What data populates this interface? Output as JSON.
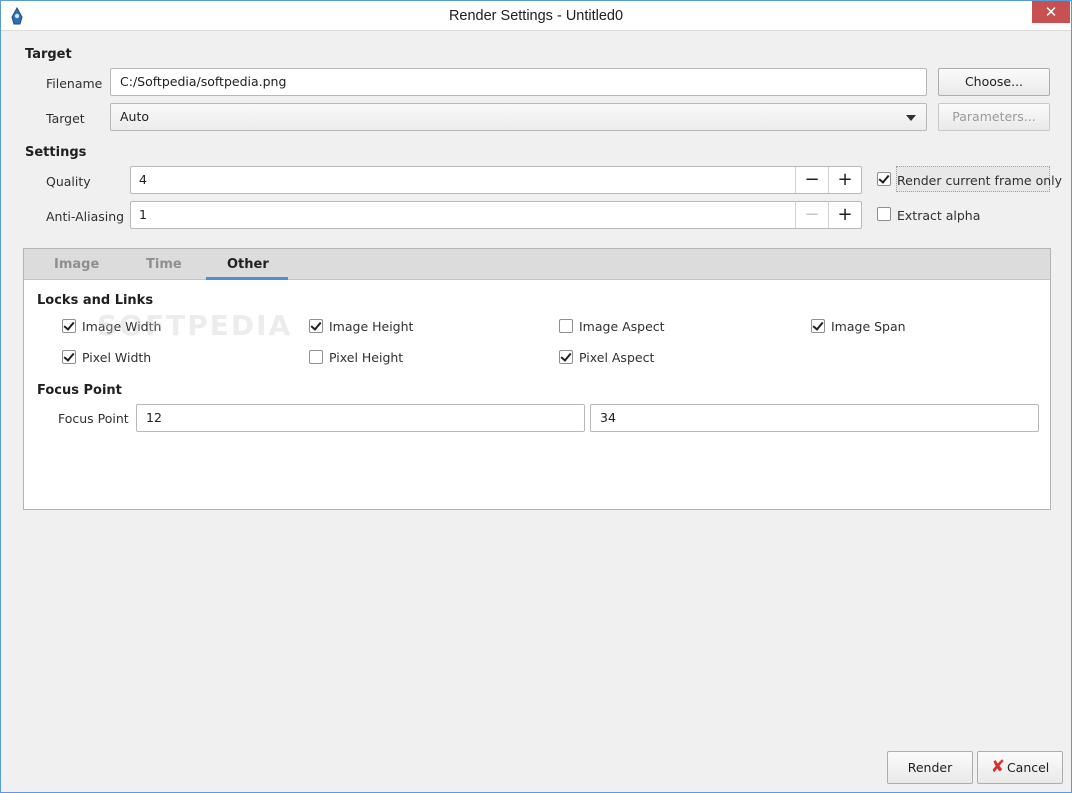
{
  "window": {
    "title": "Render Settings - Untitled0",
    "close_symbol": "✕"
  },
  "target": {
    "section_title": "Target",
    "filename_label": "Filename",
    "filename_value": "C:/Softpedia/softpedia.png",
    "choose_label": "Choose...",
    "target_label": "Target",
    "target_value": "Auto",
    "parameters_label": "Parameters..."
  },
  "settings": {
    "section_title": "Settings",
    "quality_label": "Quality",
    "quality_value": "4",
    "antialias_label": "Anti-Aliasing",
    "antialias_value": "1",
    "minus_symbol": "−",
    "plus_symbol": "+",
    "render_current_label": "Render current frame only",
    "render_current_checked": true,
    "extract_alpha_label": "Extract alpha",
    "extract_alpha_checked": false
  },
  "tabs": [
    {
      "label": "Image",
      "active": false
    },
    {
      "label": "Time",
      "active": false
    },
    {
      "label": "Other",
      "active": true
    }
  ],
  "locks": {
    "section_title": "Locks and Links",
    "items": [
      {
        "label": "Image Width",
        "checked": true
      },
      {
        "label": "Image Height",
        "checked": true
      },
      {
        "label": "Image Aspect",
        "checked": false
      },
      {
        "label": "Image Span",
        "checked": true
      },
      {
        "label": "Pixel Width",
        "checked": true
      },
      {
        "label": "Pixel Height",
        "checked": false
      },
      {
        "label": "Pixel Aspect",
        "checked": true
      }
    ]
  },
  "focus": {
    "section_title": "Focus Point",
    "label": "Focus Point",
    "x_value": "12",
    "y_value": "34"
  },
  "watermark": "SOFTPEDIA",
  "footer": {
    "render_label": "Render",
    "cancel_label": "Cancel",
    "cancel_symbol": "✘"
  }
}
